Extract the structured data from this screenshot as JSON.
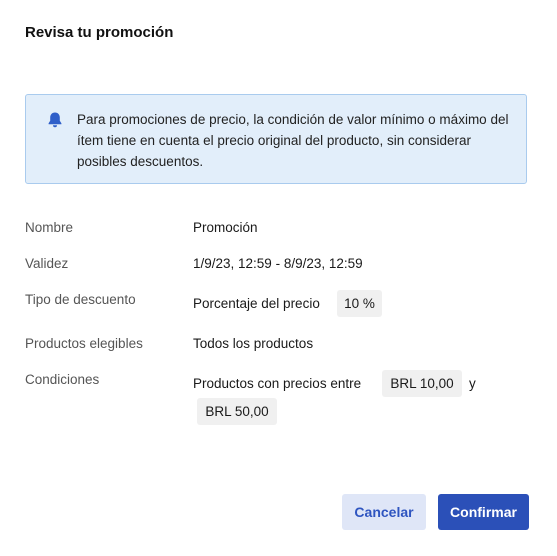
{
  "dialog": {
    "title": "Revisa tu promoción"
  },
  "notice": {
    "icon": "bell-icon",
    "text": "Para promociones de precio, la condición de valor mínimo o máximo del ítem tiene en cuenta el precio original del producto, sin considerar posibles descuentos.",
    "colors": {
      "background": "#e2eefa",
      "border": "#a9cbee",
      "icon": "#2f5fc9"
    }
  },
  "details": {
    "name": {
      "label": "Nombre",
      "value": "Promoción"
    },
    "validity": {
      "label": "Validez",
      "value": "1/9/23, 12:59 - 8/9/23, 12:59"
    },
    "discount_type": {
      "label": "Tipo de descuento",
      "value": "Porcentaje del precio",
      "chip": "10 %"
    },
    "eligible_products": {
      "label": "Productos elegibles",
      "value": "Todos los productos"
    },
    "conditions": {
      "label": "Condiciones",
      "text": "Productos con precios entre",
      "min_chip": "BRL 10,00",
      "connector": "y",
      "max_chip": "BRL 50,00"
    }
  },
  "actions": {
    "cancel_label": "Cancelar",
    "confirm_label": "Confirmar",
    "colors": {
      "cancel_bg": "#dfe6f7",
      "cancel_text": "#2f55c0",
      "confirm_bg": "#2b50b8",
      "confirm_text": "#ffffff"
    }
  }
}
